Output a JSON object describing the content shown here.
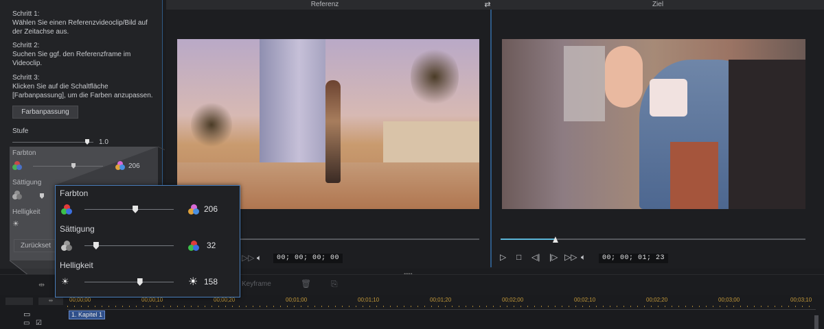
{
  "steps": [
    {
      "title": "Schritt 1:",
      "lines": [
        "Wählen Sie einen Referenzvideoclip/Bild auf",
        "der Zeitachse aus."
      ]
    },
    {
      "title": "Schritt 2:",
      "lines": [
        "Suchen Sie ggf. den Referenzframe im",
        "Videoclip."
      ]
    },
    {
      "title": "Schritt 3:",
      "lines": [
        "Klicken Sie auf die Schaltfläche",
        "[Farbanpassung], um die Farben anzupassen."
      ]
    }
  ],
  "color_match_button": "Farbanpassung",
  "level": {
    "label": "Stufe",
    "value": "1.0",
    "fraction": 0.7
  },
  "panel": {
    "hue_label": "Farbton",
    "hue_value": "206",
    "saturation_label": "Sättigung",
    "brightness_label": "Helligkeit",
    "reset_button": "Zurückset"
  },
  "zoom": {
    "hue_label": "Farbton",
    "hue_value": "206",
    "hue_fraction": 0.57,
    "saturation_label": "Sättigung",
    "saturation_value": "32",
    "saturation_fraction": 0.13,
    "brightness_label": "Helligkeit",
    "brightness_value": "158",
    "brightness_fraction": 0.62
  },
  "preview": {
    "reference_title": "Referenz",
    "target_title": "Ziel",
    "reference_timecode": "00; 00; 00; 00",
    "target_timecode": "00; 00; 01; 23",
    "target_scrub_fraction": 0.18
  },
  "toolbar": {
    "keyframe_label": "Keyframe"
  },
  "timeline": {
    "ticks": [
      "00;00;00",
      "00;00;10",
      "00;00;20",
      "00;01;00",
      "00;01;10",
      "00;01;20",
      "00;02;00",
      "00;02;10",
      "00;02;20",
      "00;03;00",
      "00;03;10"
    ],
    "chapter_label": "1. Kapitel 1"
  },
  "colors": {
    "accent": "#4a7fbd",
    "scrub_active": "#5bb7d9",
    "ruler_text": "#c59a3a"
  },
  "icons": [
    "swap-icon",
    "play-icon",
    "stop-icon",
    "prev-frame-icon",
    "next-frame-icon",
    "fast-forward-icon",
    "volume-icon",
    "hue-icon",
    "saturation-icon",
    "brightness-icon",
    "delete-icon",
    "export-icon",
    "chapter-icon",
    "subtitle-icon",
    "checkbox-icon"
  ]
}
